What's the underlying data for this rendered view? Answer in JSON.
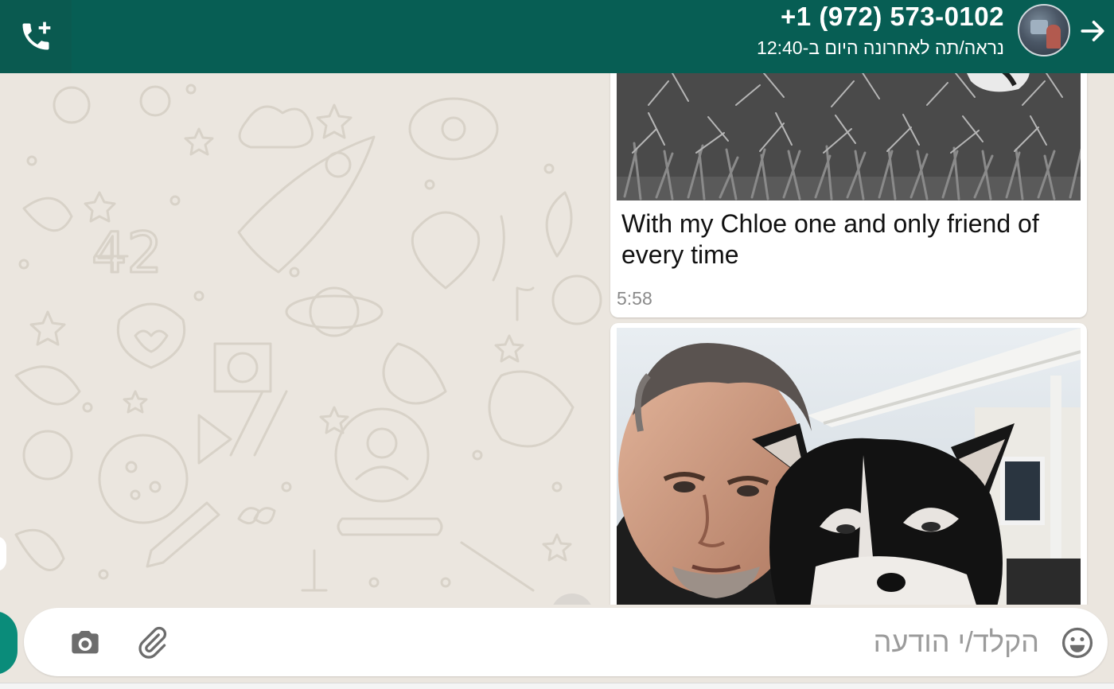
{
  "header": {
    "contact_name": "+1 (972) 573-0102",
    "status": "נראה/תה לאחרונה היום ב-12:40"
  },
  "messages": [
    {
      "type": "image",
      "caption": "With my Chloe one and only friend of every time",
      "time": "5:58"
    },
    {
      "type": "image"
    }
  ],
  "composer": {
    "placeholder": "הקלד/י הודעה"
  },
  "icons": {
    "call": "add-call-icon",
    "back": "arrow-right-icon",
    "camera": "camera-icon",
    "attach": "paperclip-icon",
    "emoji": "emoji-icon"
  },
  "colors": {
    "header": "#075e54",
    "wallpaper": "#ebe6df",
    "accent": "#0a8c7a"
  }
}
